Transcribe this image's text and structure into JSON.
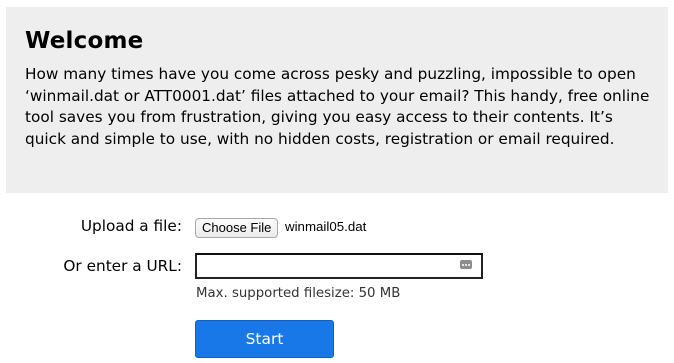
{
  "welcome": {
    "title": "Welcome",
    "text": "How many times have you come across pesky and puzzling, impossible to open ‘winmail.dat or ATT0001.dat’ files attached to your email? This handy, free online tool saves you from frustration, giving you easy access to their contents. It’s quick and simple to use, with no hidden costs, registration or email required."
  },
  "form": {
    "upload_label": "Upload a file:",
    "choose_file_label": "Choose File",
    "chosen_file": "winmail05.dat",
    "url_label": "Or enter a URL:",
    "url_value": "",
    "filesize_note": "Max. supported filesize: 50 MB",
    "start_label": "Start"
  },
  "colors": {
    "panel_background": "#eeeeee",
    "start_button": "#1878e8"
  },
  "icons": {
    "url_field_icon": "autofill-key-icon"
  }
}
